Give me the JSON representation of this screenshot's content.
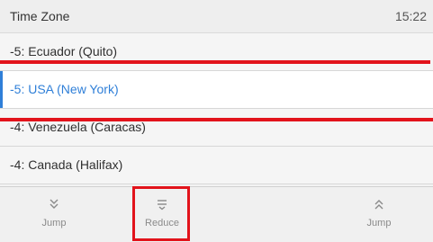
{
  "header": {
    "title": "Time Zone",
    "time": "15:22"
  },
  "timezones": [
    {
      "label": "-5: Ecuador (Quito)",
      "selected": false
    },
    {
      "label": "-5: USA (New York)",
      "selected": true
    },
    {
      "label": "-4: Venezuela (Caracas)",
      "selected": false
    },
    {
      "label": "-4: Canada (Halifax)",
      "selected": false
    }
  ],
  "softkeys": {
    "jump_down": {
      "label": "Jump",
      "icon": "double-chevron-down-icon"
    },
    "reduce": {
      "label": "Reduce",
      "icon": "reduce-icon"
    },
    "jump_up": {
      "label": "Jump",
      "icon": "double-chevron-up-icon"
    }
  },
  "colors": {
    "accent": "#2f7fd8",
    "annotation": "#e2131b"
  }
}
